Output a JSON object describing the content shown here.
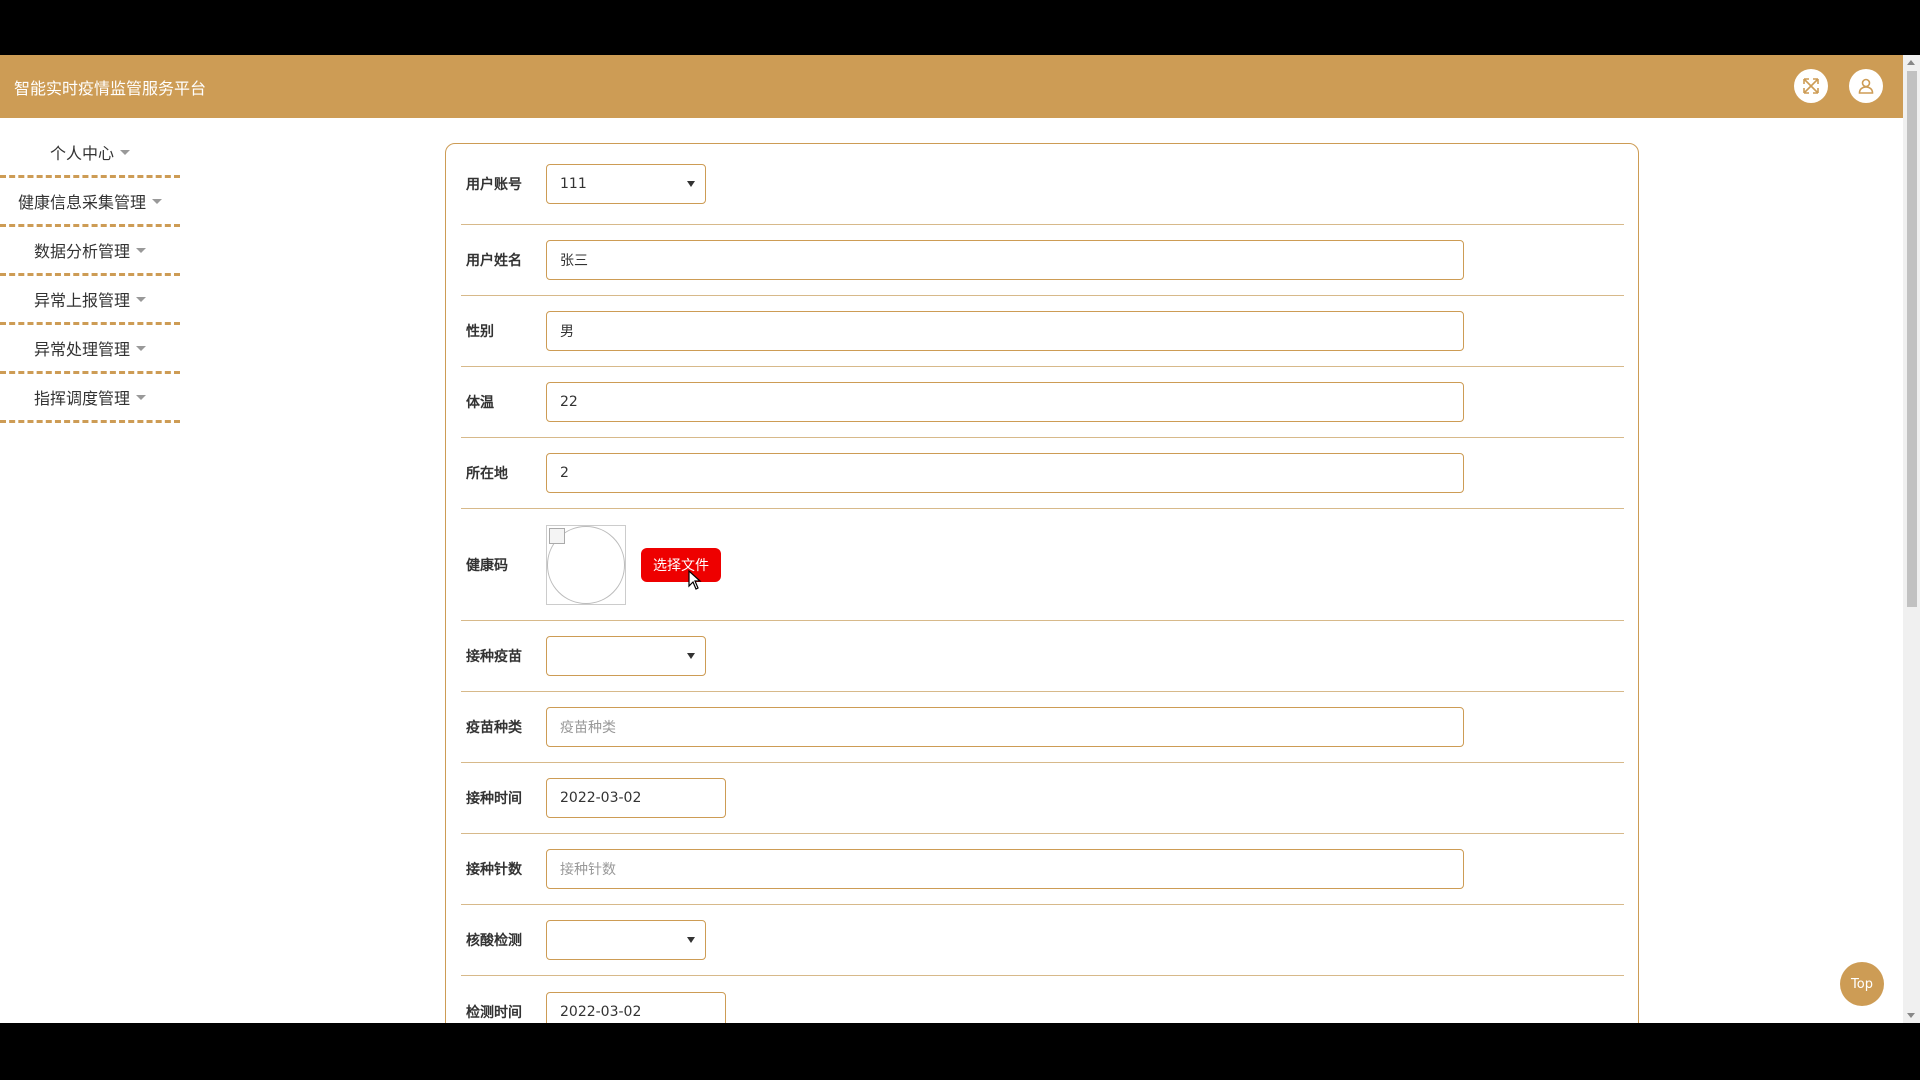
{
  "header": {
    "title": "智能实时疫情监管服务平台",
    "fullscreen_icon": "expand-icon",
    "user_icon": "user-icon"
  },
  "sidebar": {
    "items": [
      {
        "label": "个人中心"
      },
      {
        "label": "健康信息采集管理"
      },
      {
        "label": "数据分析管理"
      },
      {
        "label": "异常上报管理"
      },
      {
        "label": "异常处理管理"
      },
      {
        "label": "指挥调度管理"
      }
    ]
  },
  "form": {
    "account": {
      "label": "用户账号",
      "value": "111"
    },
    "name": {
      "label": "用户姓名",
      "value": "张三"
    },
    "gender": {
      "label": "性别",
      "value": "男"
    },
    "temperature": {
      "label": "体温",
      "value": "22"
    },
    "location": {
      "label": "所在地",
      "value": "2"
    },
    "health_code": {
      "label": "健康码",
      "button": "选择文件"
    },
    "vaccinated": {
      "label": "接种疫苗",
      "value": ""
    },
    "vaccine_type": {
      "label": "疫苗种类",
      "placeholder": "疫苗种类"
    },
    "vaccine_date": {
      "label": "接种时间",
      "value": "2022-03-02"
    },
    "doses": {
      "label": "接种针数",
      "placeholder": "接种针数"
    },
    "nucleic_test": {
      "label": "核酸检测",
      "value": ""
    },
    "test_date": {
      "label": "检测时间",
      "value": "2022-03-02"
    }
  },
  "top_button": "Top",
  "colors": {
    "accent": "#cd9c55",
    "upload": "#ee0000"
  }
}
